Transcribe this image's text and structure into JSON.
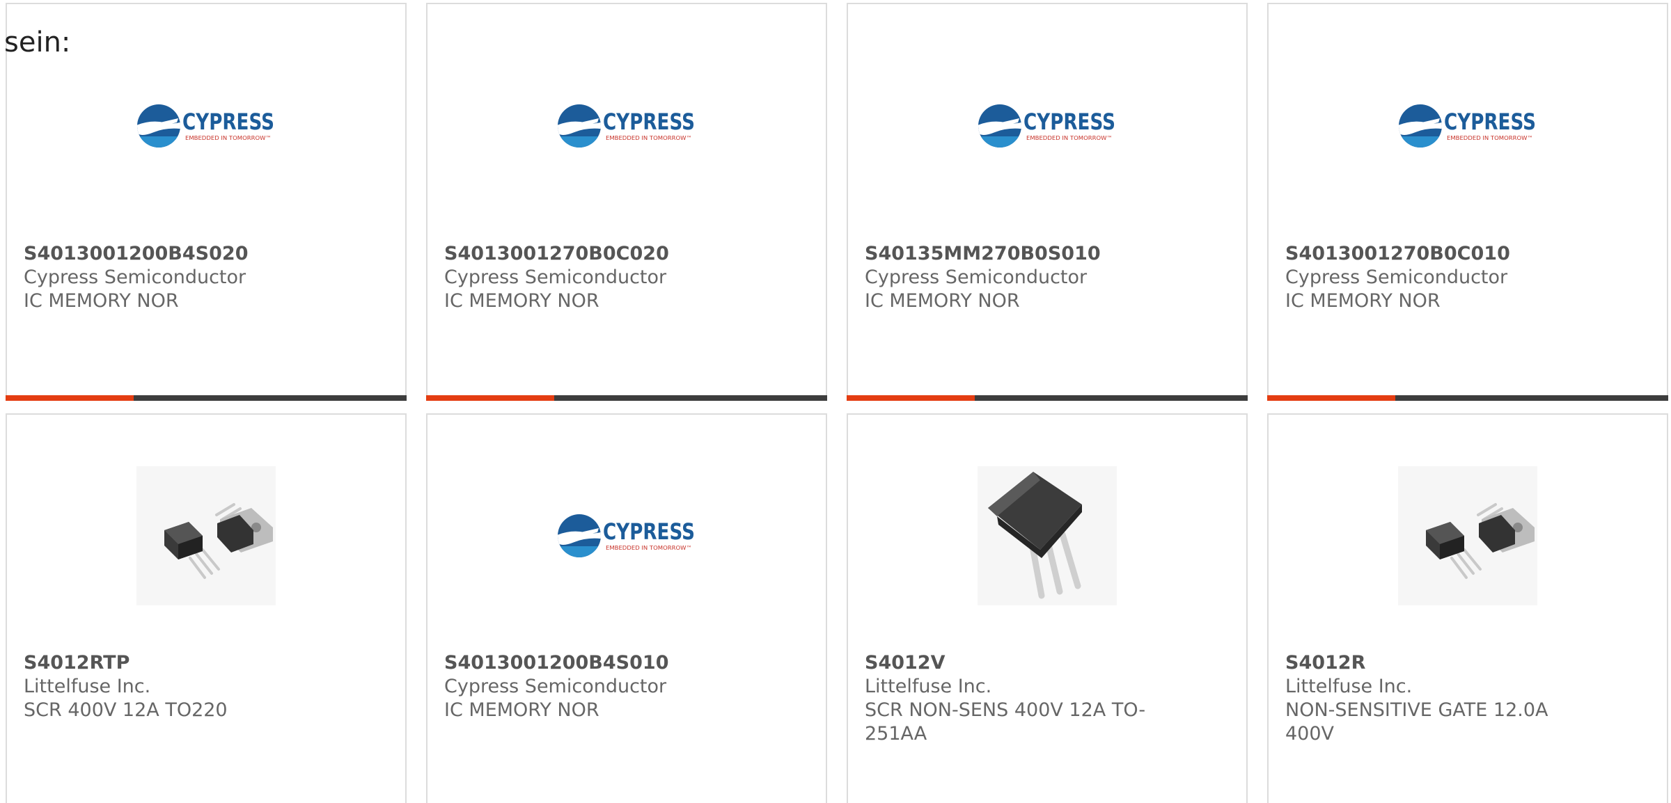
{
  "intro_text": "sein:",
  "accent_color": "#e43d12",
  "bar_color": "#3d3d3d",
  "cypress_logo": {
    "brand": "CYPRESS",
    "tagline": "EMBEDDED IN TOMORROW™"
  },
  "cards": [
    {
      "part": "S4013001200B4S020",
      "manufacturer": "Cypress Semiconductor",
      "description": "IC MEMORY NOR",
      "image": "cypress-logo"
    },
    {
      "part": "S4013001270B0C020",
      "manufacturer": "Cypress Semiconductor",
      "description": "IC MEMORY NOR",
      "image": "cypress-logo"
    },
    {
      "part": "S40135MM270B0S010",
      "manufacturer": "Cypress Semiconductor",
      "description": "IC MEMORY NOR",
      "image": "cypress-logo"
    },
    {
      "part": "S4013001270B0C010",
      "manufacturer": "Cypress Semiconductor",
      "description": "IC MEMORY NOR",
      "image": "cypress-logo"
    },
    {
      "part": "S4012RTP",
      "manufacturer": "Littelfuse Inc.",
      "description": "SCR 400V 12A TO220",
      "image": "to220-package"
    },
    {
      "part": "S4013001200B4S010",
      "manufacturer": "Cypress Semiconductor",
      "description": "IC MEMORY NOR",
      "image": "cypress-logo"
    },
    {
      "part": "S4012V",
      "manufacturer": "Littelfuse Inc.",
      "description": "SCR NON-SENS 400V 12A TO-251AA",
      "image": "to251-package"
    },
    {
      "part": "S4012R",
      "manufacturer": "Littelfuse Inc.",
      "description": "NON-SENSITIVE GATE 12.0A 400V",
      "image": "to220-package"
    }
  ]
}
